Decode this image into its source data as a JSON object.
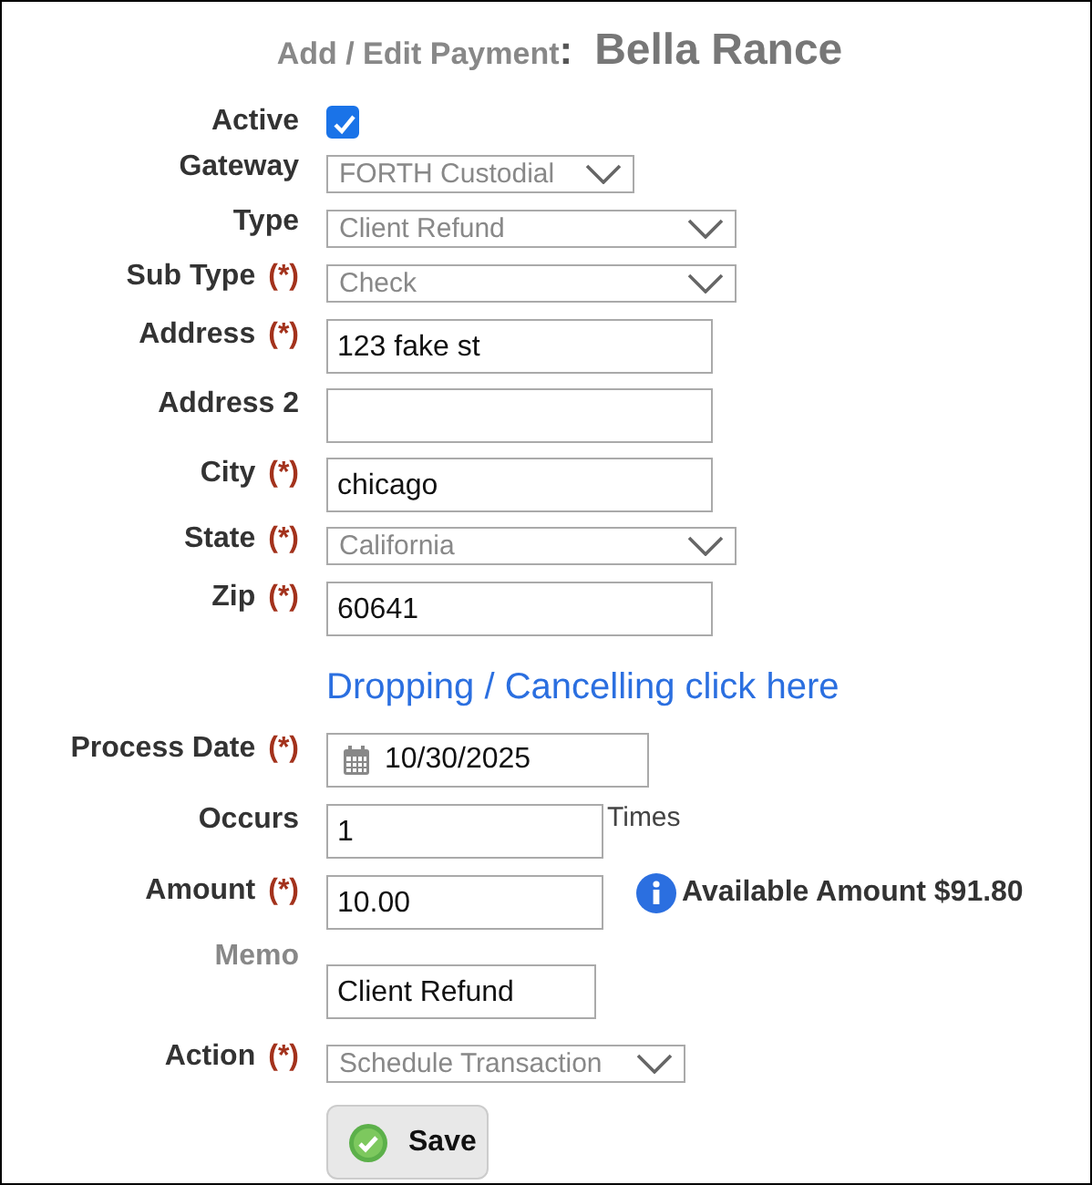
{
  "header": {
    "title": "Add / Edit Payment",
    "separator": ":",
    "name": "Bella Rance"
  },
  "rows": [
    {
      "kind": "checkbox",
      "label": "Active",
      "muted": false,
      "checked": true
    },
    {
      "kind": "select",
      "label": "Gateway",
      "muted": false,
      "value": "FORTH Custodial"
    },
    {
      "kind": "select",
      "label": "Type",
      "muted": false,
      "value": "Client Refund"
    },
    {
      "kind": "select",
      "label": "Sub Type",
      "required_mark": "(*)",
      "muted": false,
      "value": "Check"
    },
    {
      "kind": "text",
      "label": "Address",
      "required_mark": "(*)",
      "muted": false,
      "value": "123 fake st"
    },
    {
      "kind": "text",
      "label": "Address 2",
      "muted": false
    },
    {
      "kind": "text",
      "label": "City",
      "required_mark": "(*)",
      "muted": false,
      "value": "chicago"
    },
    {
      "kind": "select",
      "label": "State",
      "required_mark": "(*)",
      "muted": false,
      "value": "California"
    },
    {
      "kind": "text",
      "label": "Zip",
      "required_mark": "(*)",
      "muted": false,
      "value": "60641"
    },
    {
      "kind": "link",
      "text": "Dropping / Cancelling click here"
    },
    {
      "kind": "date",
      "label": "Process Date",
      "required_mark": "(*)",
      "muted": false,
      "value": "10/30/2025"
    },
    {
      "kind": "text",
      "label": "Occurs",
      "muted": false,
      "value": "1",
      "suffix": "Times"
    },
    {
      "kind": "text",
      "label": "Amount",
      "required_mark": "(*)",
      "muted": false,
      "value": "10.00",
      "note": "Available Amount $91.80"
    },
    {
      "kind": "text",
      "label": "Memo",
      "muted": true,
      "value": "Client Refund"
    },
    {
      "kind": "select",
      "label": "Action",
      "required_mark": "(*)",
      "muted": false,
      "value": "Schedule Transaction"
    },
    {
      "kind": "button",
      "label": "Save"
    }
  ]
}
